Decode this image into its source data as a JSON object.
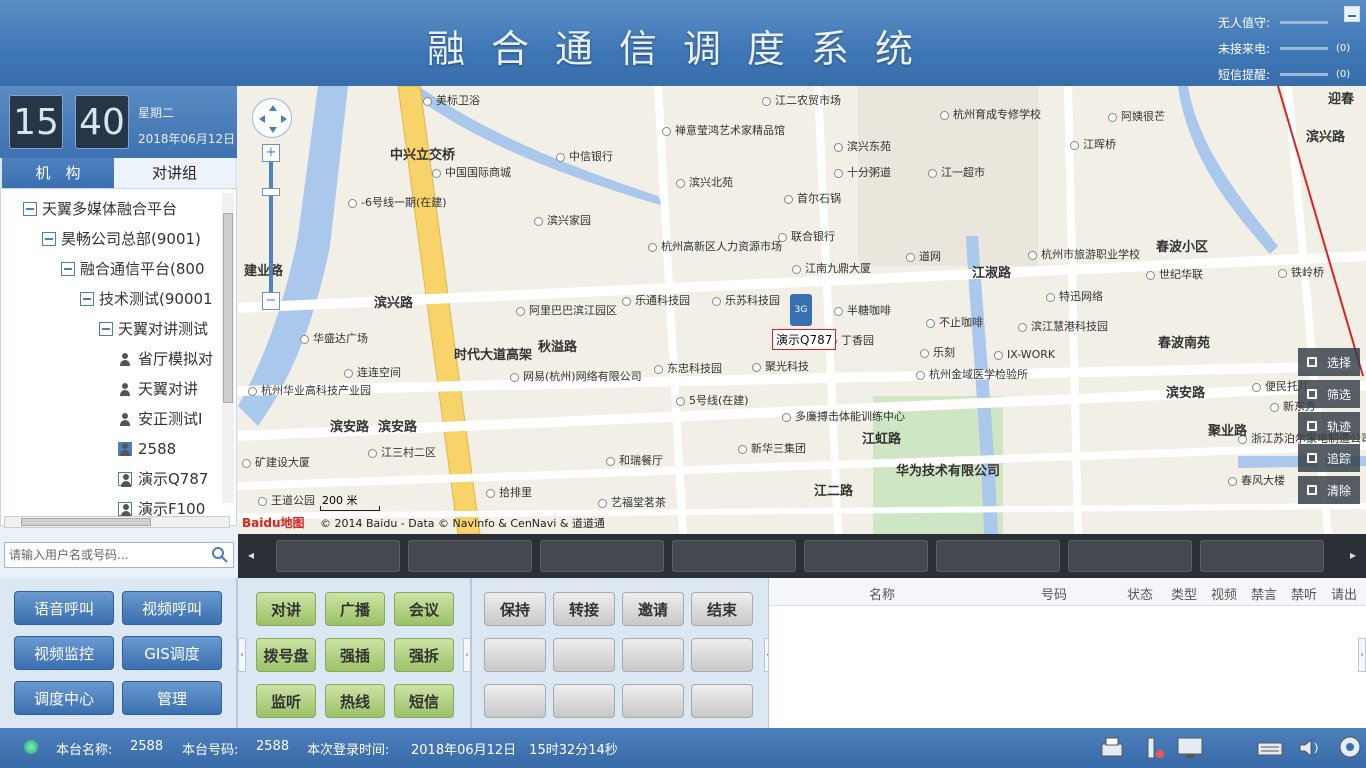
{
  "header": {
    "title": "融合通信调度系统",
    "indicators": [
      {
        "label": "无人值守:",
        "count": ""
      },
      {
        "label": "未接来电:",
        "count": "(0)"
      },
      {
        "label": "短信提醒:",
        "count": "(0)"
      }
    ]
  },
  "clock": {
    "hour": "15",
    "minute": "40",
    "weekday": "星期二",
    "date": "2018年06月12日"
  },
  "tabs": [
    "机　构",
    "对讲组"
  ],
  "tree": [
    {
      "label": "天翼多媒体融合平台",
      "level": 0,
      "type": "group"
    },
    {
      "label": "昊畅公司总部(9001)",
      "level": 1,
      "type": "group"
    },
    {
      "label": "融合通信平台(800",
      "level": 2,
      "type": "group"
    },
    {
      "label": "技术测试(90001",
      "level": 3,
      "type": "group"
    },
    {
      "label": "天翼对讲测试",
      "level": 4,
      "type": "group"
    },
    {
      "label": "省厅模拟对",
      "level": 5,
      "type": "user"
    },
    {
      "label": "天翼对讲",
      "level": 5,
      "type": "user"
    },
    {
      "label": "安正测试I",
      "level": 5,
      "type": "user"
    },
    {
      "label": "2588",
      "level": 5,
      "type": "pc"
    },
    {
      "label": "演示Q787",
      "level": 5,
      "type": "phone"
    },
    {
      "label": "演示F100",
      "level": 5,
      "type": "phone"
    }
  ],
  "search": {
    "placeholder": "请输入用户名或号码..."
  },
  "map": {
    "marker_label": "演示Q787",
    "marker_badge": "3G",
    "scale": "200 米",
    "copyright": "© 2014 Baidu - Data © NavInfo & CenNavi & 道道通",
    "logo": "Baidu地图",
    "labels": [
      {
        "t": "美标卫浴",
        "big": false
      },
      {
        "t": "江二农贸市场",
        "big": false
      },
      {
        "t": "杭州育成专修学校",
        "big": false
      },
      {
        "t": "迎春",
        "big": true
      },
      {
        "t": "阿姨很芒",
        "big": false
      },
      {
        "t": "禅意莹鸿艺术家精品馆",
        "big": false
      },
      {
        "t": "滨兴东苑",
        "big": false
      },
      {
        "t": "江晖桥",
        "big": false
      },
      {
        "t": "滨兴路",
        "big": true
      },
      {
        "t": "中兴立交桥",
        "big": true
      },
      {
        "t": "中信银行",
        "big": false
      },
      {
        "t": "中国国际商城",
        "big": false
      },
      {
        "t": "十分粥道",
        "big": false
      },
      {
        "t": "江一超市",
        "big": false
      },
      {
        "t": "滨兴北苑",
        "big": false
      },
      {
        "t": "首尔石锅",
        "big": false
      },
      {
        "t": "-6号线一期(在建)",
        "big": false
      },
      {
        "t": "滨兴家园",
        "big": false
      },
      {
        "t": "联合银行",
        "big": false
      },
      {
        "t": "杭州高新区人力资源市场",
        "big": false
      },
      {
        "t": "道网",
        "big": false
      },
      {
        "t": "杭州市旅游职业学校",
        "big": false
      },
      {
        "t": "春波小区",
        "big": true
      },
      {
        "t": "建业路",
        "big": true
      },
      {
        "t": "江南九鼎大厦",
        "big": false
      },
      {
        "t": "江淑路",
        "big": true
      },
      {
        "t": "世纪华联",
        "big": false
      },
      {
        "t": "铁岭桥",
        "big": false
      },
      {
        "t": "滨兴路",
        "big": true
      },
      {
        "t": "阿里巴巴滨江园区",
        "big": false
      },
      {
        "t": "乐通科技园",
        "big": false
      },
      {
        "t": "乐苏科技园",
        "big": false
      },
      {
        "t": "半糖咖啡",
        "big": false
      },
      {
        "t": "特迅网络",
        "big": false
      },
      {
        "t": "华盛达广场",
        "big": false
      },
      {
        "t": "秋溢路",
        "big": true
      },
      {
        "t": "丁香园",
        "big": false
      },
      {
        "t": "不止咖啡",
        "big": false
      },
      {
        "t": "滨江慧港科技园",
        "big": false
      },
      {
        "t": "春波南苑",
        "big": true
      },
      {
        "t": "时代大道高架",
        "big": true
      },
      {
        "t": "乐刻",
        "big": false
      },
      {
        "t": "IX-WORK",
        "big": false
      },
      {
        "t": "连连空间",
        "big": false
      },
      {
        "t": "东忠科技园",
        "big": false
      },
      {
        "t": "聚光科技",
        "big": false
      },
      {
        "t": "杭州金域医学检验所",
        "big": false
      },
      {
        "t": "网易(杭州)网络有限公司",
        "big": false
      },
      {
        "t": "杭州华业高科技产业园",
        "big": false
      },
      {
        "t": "滨安路",
        "big": true
      },
      {
        "t": "便民托儿",
        "big": false
      },
      {
        "t": "滨安路",
        "big": true
      },
      {
        "t": "滨安路",
        "big": true
      },
      {
        "t": "多廉搏击体能训练中心",
        "big": false
      },
      {
        "t": "新东方",
        "big": false
      },
      {
        "t": "5号线(在建)",
        "big": false
      },
      {
        "t": "江三村二区",
        "big": false
      },
      {
        "t": "新华三集团",
        "big": false
      },
      {
        "t": "江虹路",
        "big": true
      },
      {
        "t": "华为技术有限公司",
        "big": true
      },
      {
        "t": "浙江苏泊尔家电制造公司",
        "big": false
      },
      {
        "t": "聚业路",
        "big": true
      },
      {
        "t": "和瑞餐厅",
        "big": false
      },
      {
        "t": "江二路",
        "big": true
      },
      {
        "t": "春风大楼",
        "big": false
      },
      {
        "t": "矿建设大厦",
        "big": false
      },
      {
        "t": "拾排里",
        "big": false
      },
      {
        "t": "艺福堂茗茶",
        "big": false
      },
      {
        "t": "王道公园",
        "big": false
      }
    ],
    "side_buttons": [
      "选择",
      "筛选",
      "轨迹",
      "追踪",
      "清除"
    ]
  },
  "left_buttons": [
    "语音呼叫",
    "视频呼叫",
    "视频监控",
    "GIS调度",
    "调度中心",
    "管理"
  ],
  "green_buttons": [
    "对讲",
    "广播",
    "会议",
    "拨号盘",
    "强插",
    "强拆",
    "监听",
    "热线",
    "短信"
  ],
  "gray_buttons": [
    "保持",
    "转接",
    "邀请",
    "结束"
  ],
  "table_headers": [
    "名称",
    "号码",
    "状态",
    "类型",
    "视频",
    "禁言",
    "禁听",
    "请出"
  ],
  "status": {
    "name_label": "本台名称:",
    "name": "2588",
    "number_label": "本台号码:",
    "number": "2588",
    "login_label": "本次登录时间:",
    "login_time": "2018年06月12日　15时32分14秒"
  },
  "colors": {
    "accent": "#3a6fb0",
    "green_btn": "#9cc167",
    "status_ok": "#2fd18b"
  }
}
